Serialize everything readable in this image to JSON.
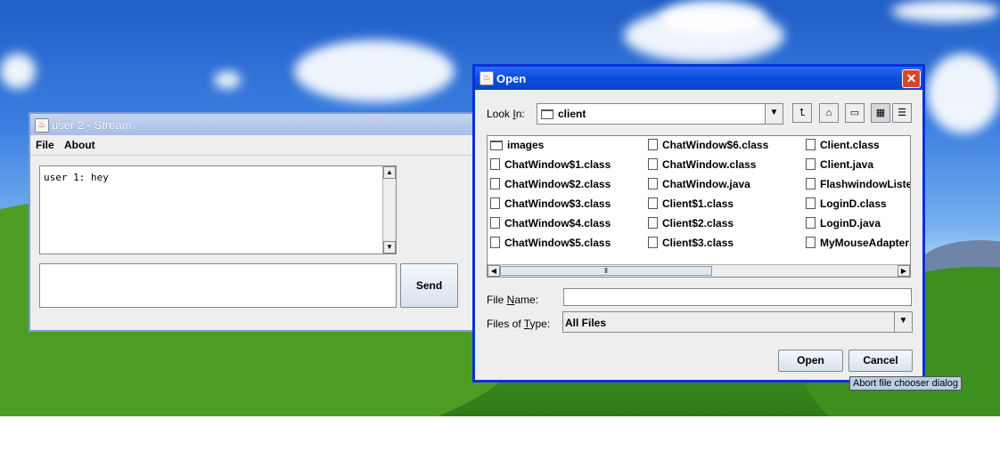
{
  "stream_window": {
    "title": "user 2 - Stream",
    "menu": [
      {
        "label": "File"
      },
      {
        "label": "About"
      }
    ],
    "chat_text": "user 1: hey",
    "input_value": "",
    "send_label": "Send"
  },
  "open_dialog": {
    "title": "Open",
    "close_glyph": "✕",
    "look_in_label_pre": "Look ",
    "look_in_label_mnemonic": "I",
    "look_in_label_post": "n:",
    "look_in_value": "client",
    "toolbar_icons": [
      "up-folder-icon",
      "home-icon",
      "new-folder-icon",
      "list-view-icon",
      "details-view-icon"
    ],
    "files": [
      {
        "name": "images",
        "type": "folder"
      },
      {
        "name": "ChatWindow$1.class",
        "type": "file"
      },
      {
        "name": "ChatWindow$2.class",
        "type": "file"
      },
      {
        "name": "ChatWindow$3.class",
        "type": "file"
      },
      {
        "name": "ChatWindow$4.class",
        "type": "file"
      },
      {
        "name": "ChatWindow$5.class",
        "type": "file"
      },
      {
        "name": "ChatWindow$6.class",
        "type": "file"
      },
      {
        "name": "ChatWindow.class",
        "type": "file"
      },
      {
        "name": "ChatWindow.java",
        "type": "file"
      },
      {
        "name": "Client$1.class",
        "type": "file"
      },
      {
        "name": "Client$2.class",
        "type": "file"
      },
      {
        "name": "Client$3.class",
        "type": "file"
      },
      {
        "name": "Client.class",
        "type": "file"
      },
      {
        "name": "Client.java",
        "type": "file"
      },
      {
        "name": "FlashwindowListe",
        "type": "file"
      },
      {
        "name": "LoginD.class",
        "type": "file"
      },
      {
        "name": "LoginD.java",
        "type": "file"
      },
      {
        "name": "MyMouseAdapter",
        "type": "file"
      }
    ],
    "file_name_label_pre": "File ",
    "file_name_label_mnemonic": "N",
    "file_name_label_post": "ame:",
    "file_name_value": "",
    "files_of_type_label_pre": "Files of ",
    "files_of_type_label_mnemonic": "T",
    "files_of_type_label_post": "ype:",
    "files_of_type_value": "All Files",
    "open_label": "Open",
    "cancel_label": "Cancel"
  },
  "tooltip": "Abort file chooser dialog"
}
